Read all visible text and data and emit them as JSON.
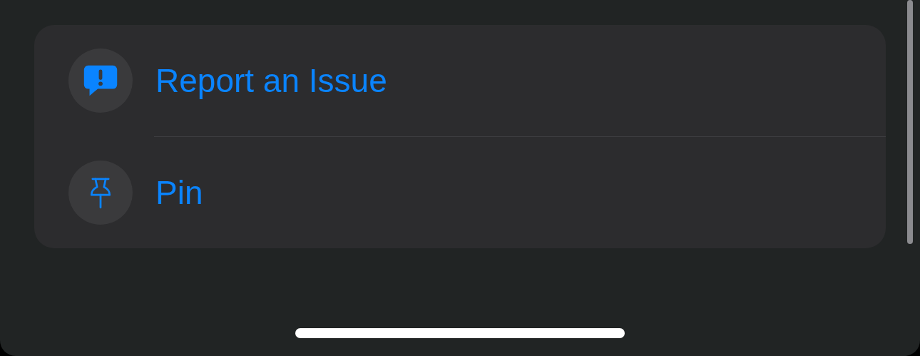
{
  "actions": [
    {
      "kind": "report",
      "label": "Report an Issue"
    },
    {
      "kind": "pin",
      "label": "Pin"
    }
  ]
}
